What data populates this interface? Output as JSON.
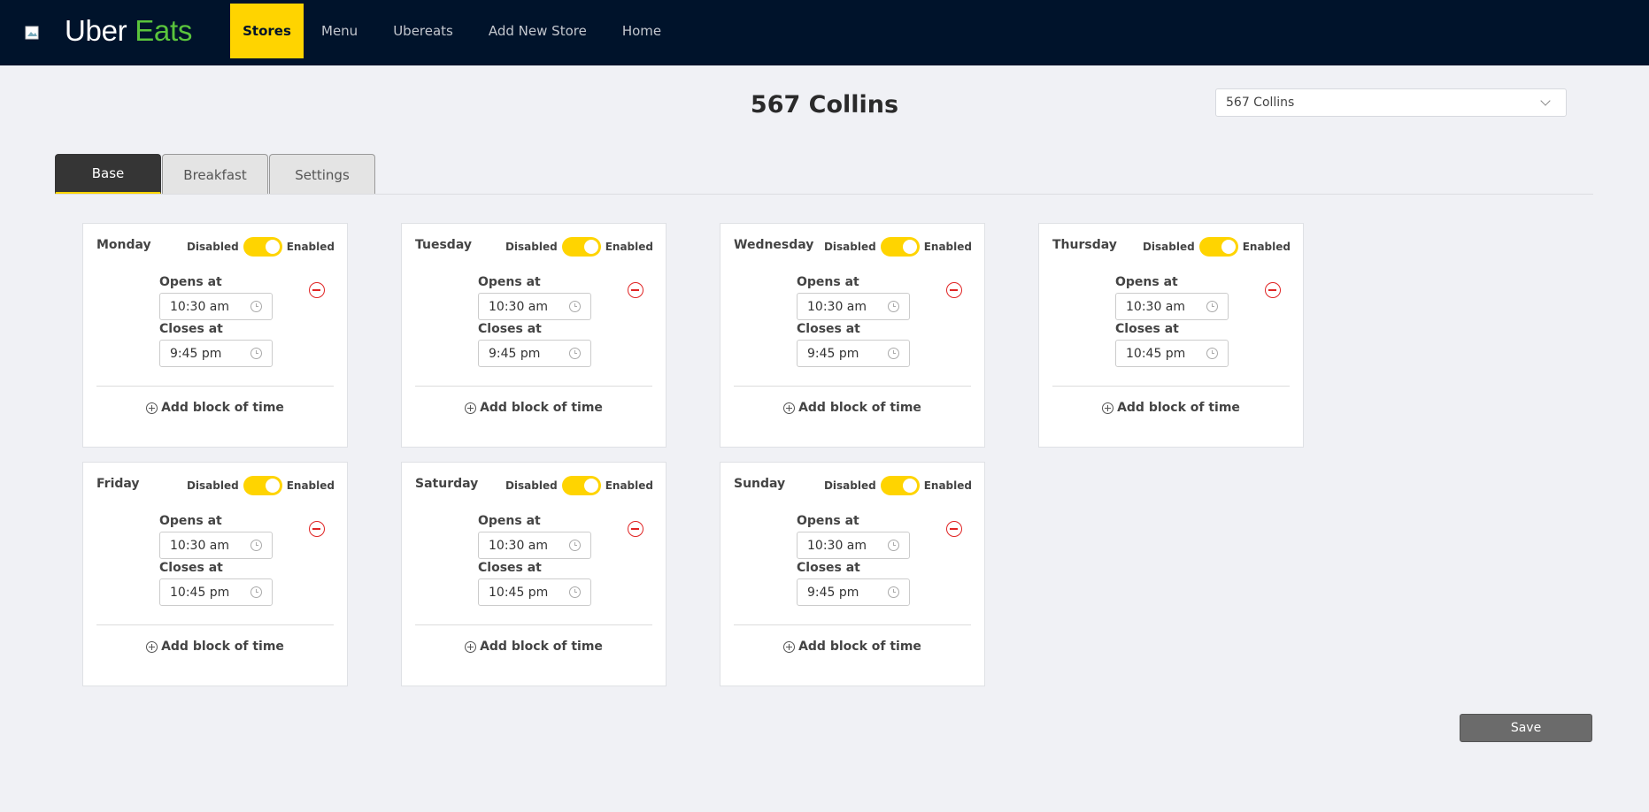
{
  "header": {
    "brand_part1": "Uber",
    "brand_part2": "Eats",
    "nav": [
      "Stores",
      "Menu",
      "Ubereats",
      "Add New Store",
      "Home"
    ],
    "active_nav": "Stores"
  },
  "page": {
    "title": "567 Collins"
  },
  "store_select": {
    "value": "567 Collins"
  },
  "tabs": [
    "Base",
    "Breakfast",
    "Settings"
  ],
  "active_tab": "Base",
  "toggle_labels": {
    "off": "Disabled",
    "on": "Enabled"
  },
  "labels": {
    "opens": "Opens at",
    "closes": "Closes at",
    "add_block": "Add block of time"
  },
  "days": [
    {
      "name": "Monday",
      "enabled": true,
      "opens": "10:30 am",
      "closes": "9:45 pm"
    },
    {
      "name": "Tuesday",
      "enabled": true,
      "opens": "10:30 am",
      "closes": "9:45 pm"
    },
    {
      "name": "Wednesday",
      "enabled": true,
      "opens": "10:30 am",
      "closes": "9:45 pm"
    },
    {
      "name": "Thursday",
      "enabled": true,
      "opens": "10:30 am",
      "closes": "10:45 pm"
    },
    {
      "name": "Friday",
      "enabled": true,
      "opens": "10:30 am",
      "closes": "10:45 pm"
    },
    {
      "name": "Saturday",
      "enabled": true,
      "opens": "10:30 am",
      "closes": "10:45 pm"
    },
    {
      "name": "Sunday",
      "enabled": true,
      "opens": "10:30 am",
      "closes": "9:45 pm"
    }
  ],
  "save_label": "Save",
  "colors": {
    "topbar": "#00132b",
    "accent": "#ffd400",
    "brand_green": "#5ac43c",
    "remove": "#e02424"
  }
}
